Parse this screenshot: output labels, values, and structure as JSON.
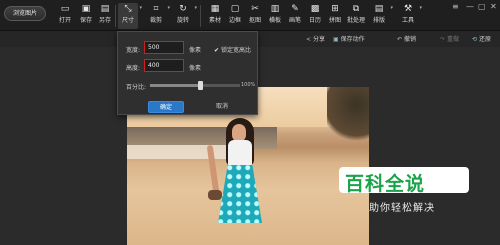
{
  "toolbar": {
    "browse_label": "浏览图片",
    "tools": [
      {
        "label": "打开",
        "icon": "open-icon"
      },
      {
        "label": "保存",
        "icon": "save-icon"
      },
      {
        "label": "另存",
        "icon": "save-as-icon"
      },
      {
        "label": "尺寸",
        "icon": "resize-icon"
      },
      {
        "label": "裁剪",
        "icon": "crop-icon"
      },
      {
        "label": "旋转",
        "icon": "rotate-icon"
      },
      {
        "label": "素材",
        "icon": "material-icon"
      },
      {
        "label": "边框",
        "icon": "border-icon"
      },
      {
        "label": "抠图",
        "icon": "cutout-icon"
      },
      {
        "label": "横板",
        "icon": "template-icon"
      },
      {
        "label": "画笔",
        "icon": "brush-icon"
      },
      {
        "label": "日历",
        "icon": "calendar-icon"
      },
      {
        "label": "拼图",
        "icon": "collage-icon"
      },
      {
        "label": "批处理",
        "icon": "batch-icon"
      },
      {
        "label": "排版",
        "icon": "layout-icon"
      },
      {
        "label": "工具",
        "icon": "tools-icon"
      }
    ]
  },
  "subbar": {
    "share": "分享",
    "save_action": "保存动作",
    "undo": "撤销",
    "redo": "重做",
    "restore": "还原"
  },
  "dialog": {
    "width_label": "宽度:",
    "width_value": "500",
    "height_label": "高度:",
    "height_value": "400",
    "unit": "像素",
    "lock_label": "锁定宽高比",
    "percent_label": "百分比:",
    "percent_value": "100%",
    "percent": 0.55,
    "ok": "确定",
    "cancel": "取消"
  },
  "watermark": {
    "main": "百科全说",
    "sub": "助你轻松解决"
  },
  "colors": {
    "accent": "#2a78c8",
    "highlight": "#cc1f1f",
    "brand_green": "#1aa34a"
  }
}
